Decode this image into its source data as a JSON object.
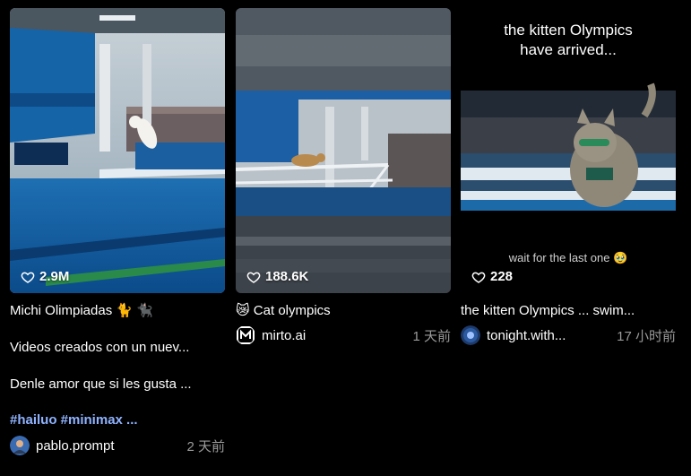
{
  "cards": [
    {
      "likes": "2.9M",
      "title": "Michi Olimpiadas 🐈 🐈‍⬛",
      "desc_line1": "Videos creados con un nuev...",
      "desc_line2": "Denle amor que si les gusta ...",
      "hashtags": "#hailuo #minimax ...",
      "author": "pablo.prompt",
      "time": "2 天前"
    },
    {
      "likes": "188.6K",
      "title": "😿 Cat olympics",
      "author": "mirto.ai",
      "time": "1 天前"
    },
    {
      "likes": "228",
      "overlay_top": "the kitten Olympics\nhave arrived...",
      "overlay_caption": "wait for the last one 🥹",
      "title": "the kitten Olympics ... swim...",
      "author": "tonight.with...",
      "time": "17 小时前"
    }
  ]
}
